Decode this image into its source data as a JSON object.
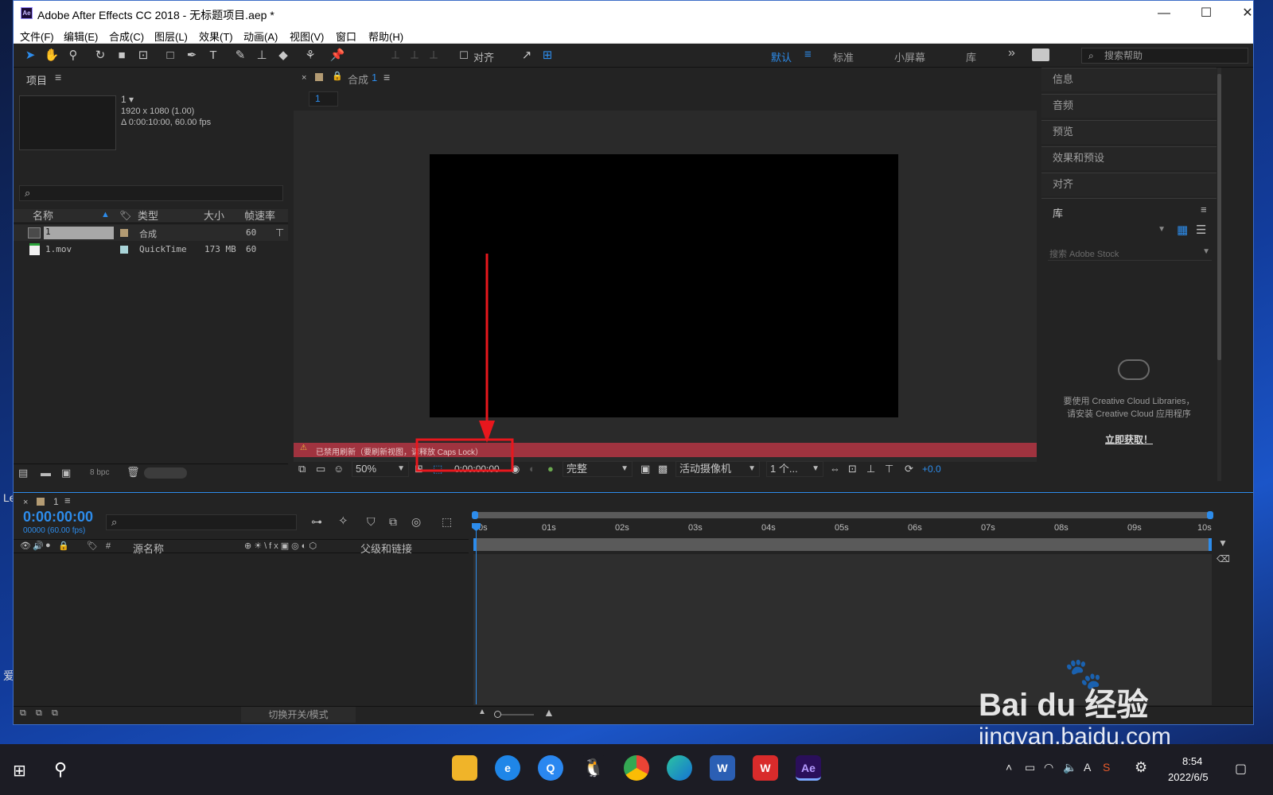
{
  "window": {
    "title": "Adobe After Effects CC 2018 - 无标题项目.aep *",
    "app_icon": "Ae",
    "minimize": "—",
    "maximize": "☐",
    "close": "✕"
  },
  "menu": [
    "文件(F)",
    "编辑(E)",
    "合成(C)",
    "图层(L)",
    "效果(T)",
    "动画(A)",
    "视图(V)",
    "窗口",
    "帮助(H)"
  ],
  "toolbar": {
    "align_label": "对齐",
    "workspaces": [
      "默认",
      "标准",
      "小屏幕",
      "库"
    ],
    "overflow": "»",
    "help_placeholder": "搜索帮助"
  },
  "project": {
    "title": "项目",
    "comp_name": "1 ▾",
    "comp_res": "1920 x 1080 (1.00)",
    "comp_dur": "Δ 0:00:10:00, 60.00 fps",
    "columns": [
      "名称",
      "类型",
      "大小",
      "帧速率"
    ],
    "items": [
      {
        "name": "1",
        "type": "合成",
        "size": "",
        "fps": "60",
        "color": "#b39b73"
      },
      {
        "name": "1.mov",
        "type": "QuickTime",
        "size": "173 MB",
        "fps": "60",
        "color": "#a9d4d8"
      }
    ],
    "bpc": "8 bpc"
  },
  "composition": {
    "tab_label": "合成",
    "tab_num": "1",
    "flow_tab": "1",
    "warning": "已禁用刷新（要刷新视图，请释放 Caps Lock）",
    "zoom": "50%",
    "timecode": "0:00:00:00",
    "quality": "完整",
    "camera": "活动摄像机",
    "views": "1 个...",
    "exposure": "+0.0"
  },
  "right_panels": [
    "信息",
    "音频",
    "预览",
    "效果和预设",
    "对齐"
  ],
  "library": {
    "title": "库",
    "search_placeholder": "搜索 Adobe Stock",
    "message_line1": "要使用 Creative Cloud Libraries，",
    "message_line2": "请安装 Creative Cloud 应用程序",
    "get_now": "立即获取！"
  },
  "timeline": {
    "tab": "1",
    "timecode": "0:00:00:00",
    "frames": "00000 (60.00 fps)",
    "col_source": "源名称",
    "col_parent": "父级和链接",
    "col_num": "#",
    "ruler": [
      "0s",
      "01s",
      "02s",
      "03s",
      "04s",
      "05s",
      "06s",
      "07s",
      "08s",
      "09s",
      "10s"
    ],
    "toggle_label": "切换开关/模式"
  },
  "taskbar": {
    "time": "8:54",
    "date": "2022/6/5",
    "ime": "A"
  },
  "watermark": {
    "brand": "Bai du 经验",
    "url": "jingyan.baidu.com"
  },
  "desktop_edge": {
    "text_a": "Le",
    "text_b": "爱"
  },
  "colors": {
    "accent": "#2d8ceb",
    "warning_bar": "#a0333f",
    "annotation": "#e8171d"
  }
}
